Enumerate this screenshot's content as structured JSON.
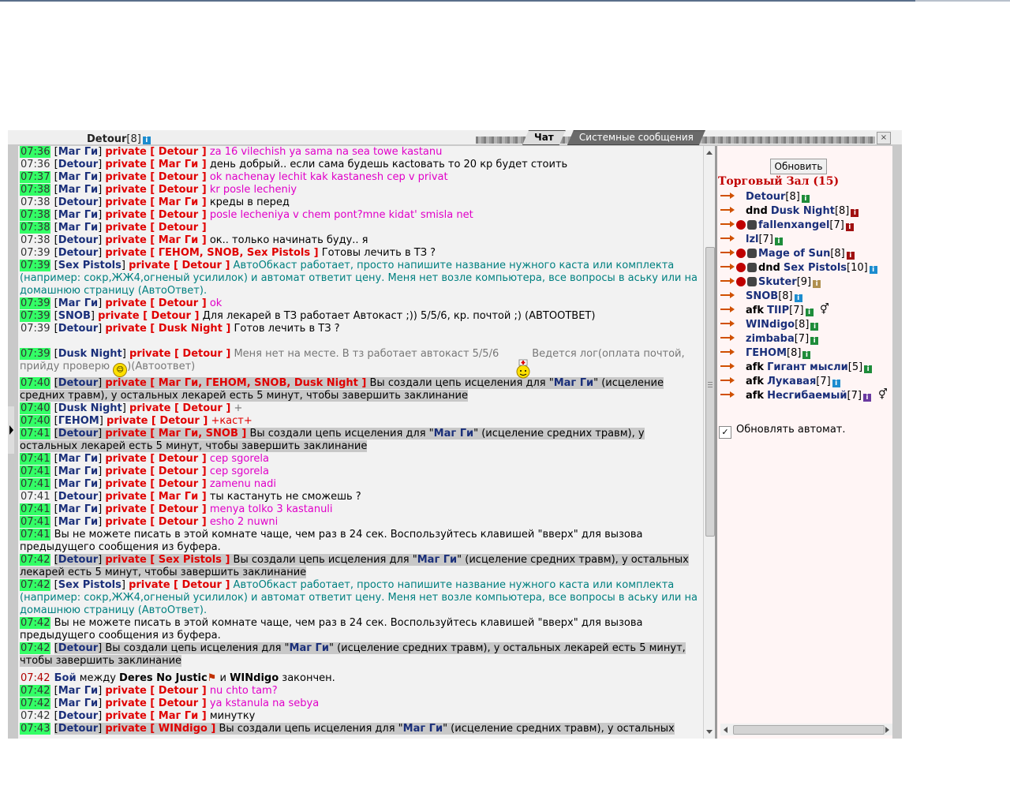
{
  "self": {
    "name": "Detour",
    "level": "[8]"
  },
  "tabs": [
    {
      "label": "Чат"
    },
    {
      "label": "Системные сообщения"
    }
  ],
  "messages": [
    {
      "time": "07:36",
      "tstyle": "g",
      "from": "Маг Ги",
      "priv": "private [ Detour ]",
      "text": "za 16 vilechish ya sama na sea towe kastanu",
      "tc": "mag"
    },
    {
      "time": "07:36",
      "tstyle": "p",
      "from": "Detour",
      "priv": "private [ Маг Ги ]",
      "text": "день добрый.. если сама будешь касtовать то 20 кр будет стоить",
      "tc": "blk"
    },
    {
      "time": "07:37",
      "tstyle": "g",
      "from": "Маг Ги",
      "priv": "private [ Detour ]",
      "text": "ok nachenay lechit kak kastanesh cep v privat",
      "tc": "mag"
    },
    {
      "time": "07:38",
      "tstyle": "g",
      "from": "Маг Ги",
      "priv": "private [ Detour ]",
      "text": "kr posle lecheniy",
      "tc": "mag"
    },
    {
      "time": "07:38",
      "tstyle": "p",
      "from": "Detour",
      "priv": "private [ Маг Ги ]",
      "text": "креды в перед",
      "tc": "blk"
    },
    {
      "time": "07:38",
      "tstyle": "g",
      "from": "Маг Ги",
      "priv": "private [ Detour ]",
      "text": "posle lecheniya v chem pont?mne kidat' smisla net",
      "tc": "mag"
    },
    {
      "time": "07:38",
      "tstyle": "g",
      "from": "Маг Ги",
      "priv": "private [ Detour ]",
      "text": "",
      "tc": "mag"
    },
    {
      "time": "07:38",
      "tstyle": "p",
      "from": "Detour",
      "priv": "private [ Маг Ги ]",
      "text": "ок.. только начинать буду.. я",
      "tc": "blk"
    },
    {
      "time": "07:39",
      "tstyle": "p",
      "from": "Detour",
      "priv": "private [ ГЕНОМ, SNOB, Sex Pistols ]",
      "text": "Готовы лечить в ТЗ ?",
      "tc": "blk"
    },
    {
      "time": "07:39",
      "tstyle": "g",
      "from": "Sex Pistols",
      "priv": "private [ Detour ]",
      "text": "АвтоОбкаст работает, просто напишите название нужного каста или комплекта (например: сокр,ЖЖ4,огненый усилилок) и автомат ответит цену. Меня нет возле компьютера, все вопросы в аську или на домашнюю страницу (АвтоОтвет).",
      "tc": "teal"
    },
    {
      "time": "07:39",
      "tstyle": "g",
      "from": "Маг Ги",
      "priv": "private [ Detour ]",
      "text": "ok",
      "tc": "mag"
    },
    {
      "time": "07:39",
      "tstyle": "g",
      "from": "SNOB",
      "priv": "private [ Detour ]",
      "text": "Для лекарей в ТЗ работает Автокаст ;)) 5/5/6, кр. почтой ;) (АВТООТВЕТ)",
      "tc": "blk"
    },
    {
      "time": "07:39",
      "tstyle": "p",
      "from": "Detour",
      "priv": "private [ Dusk Night ]",
      "text": "Готов лечить в ТЗ ?",
      "tc": "blk"
    }
  ],
  "msg_dusk": {
    "time": "07:39",
    "from": "Dusk Night",
    "priv": "private [ Detour ]",
    "text1": "Меня нет на месте. В тз работает автокаст 5/5/6",
    "text2": "Ведется лог(оплата почтой,",
    "text3": "прийду проверю",
    "text4": ")(Автоответ)"
  },
  "messages2": [
    {
      "time": "07:40",
      "tstyle": "g",
      "from": "Detour",
      "priv": "private [ Маг Ги, ГЕНОМ, SNOB, Dusk Night ]",
      "pre": "Вы создали цепь исцеления для \"",
      "target": "Маг Ги",
      "post": "\" (исцеление средних травм), у остальных лекарей есть 5 минут, чтобы завершить заклинание",
      "hl": true
    },
    {
      "time": "07:40",
      "tstyle": "g",
      "from": "Dusk Night",
      "priv": "private [ Detour ]",
      "text": "+",
      "tc": "gray"
    },
    {
      "time": "07:40",
      "tstyle": "g",
      "from": "ГЕНОМ",
      "priv": "private [ Detour ]",
      "text": "+каст+",
      "tc": "red"
    },
    {
      "time": "07:41",
      "tstyle": "g",
      "from": "Detour",
      "priv": "private [ Маг Ги, SNOB ]",
      "pre": "Вы создали цепь исцеления для \"",
      "target": "Маг Ги",
      "post": "\" (исцеление средних травм), у остальных лекарей есть 5 минут, чтобы завершить заклинание",
      "hl": true
    },
    {
      "time": "07:41",
      "tstyle": "g",
      "from": "Маг Ги",
      "priv": "private [ Detour ]",
      "text": "cep sgorela",
      "tc": "mag"
    },
    {
      "time": "07:41",
      "tstyle": "g",
      "from": "Маг Ги",
      "priv": "private [ Detour ]",
      "text": "cep sgorela",
      "tc": "mag"
    },
    {
      "time": "07:41",
      "tstyle": "g",
      "from": "Маг Ги",
      "priv": "private [ Detour ]",
      "text": "zamenu nadi",
      "tc": "mag"
    },
    {
      "time": "07:41",
      "tstyle": "p",
      "from": "Detour",
      "priv": "private [ Маг Ги ]",
      "text": "ты кастануть не сможешь ?",
      "tc": "blk"
    },
    {
      "time": "07:41",
      "tstyle": "g",
      "from": "Маг Ги",
      "priv": "private [ Detour ]",
      "text": "menya tolko 3 kastanuli",
      "tc": "mag"
    },
    {
      "time": "07:41",
      "tstyle": "g",
      "from": "Маг Ги",
      "priv": "private [ Detour ]",
      "text": "esho 2 nuwni",
      "tc": "mag"
    },
    {
      "time": "07:41",
      "tstyle": "g",
      "sys": "Вы не можете писать в этой комнате чаще, чем раз в 24 сек. Воспользуйтесь клавишей \"вверх\" для вызова предыдущего сообщения из буфера."
    },
    {
      "time": "07:42",
      "tstyle": "g",
      "from": "Detour",
      "priv": "private [ Sex Pistols ]",
      "pre": "Вы создали цепь исцеления для \"",
      "target": "Маг Ги",
      "post": "\" (исцеление средних травм), у остальных лекарей есть 5 минут, чтобы завершить заклинание",
      "hl": true
    },
    {
      "time": "07:42",
      "tstyle": "g",
      "from": "Sex Pistols",
      "priv": "private [ Detour ]",
      "text": "АвтоОбкаст работает, просто напишите название нужного каста или комплекта (например: сокр,ЖЖ4,огненый усилилок) и автомат ответит цену. Меня нет возле компьютера, все вопросы в аську или на домашнюю страницу (АвтоОтвет).",
      "tc": "teal"
    },
    {
      "time": "07:42",
      "tstyle": "g",
      "sys": "Вы не можете писать в этой комнате чаще, чем раз в 24 сек. Воспользуйтесь клавишей \"вверх\" для вызова предыдущего сообщения из буфера."
    },
    {
      "time": "07:42",
      "tstyle": "g",
      "from": "Detour",
      "priv": "",
      "pre": "Вы создали цепь исцеления для \"",
      "target": "Маг Ги",
      "post": "\" (исцеление средних травм), у остальных лекарей есть 5 минут, чтобы завершить заклинание",
      "hl": true
    }
  ],
  "battle": {
    "time": "07:42",
    "label": "Бой",
    "between": "между",
    "p1": "Deres No Justic",
    "and": "и",
    "p2": "WINdigo",
    "end": "закончен."
  },
  "messages3": [
    {
      "time": "07:42",
      "tstyle": "g",
      "from": "Маг Ги",
      "priv": "private [ Detour ]",
      "text": "nu chto tam?",
      "tc": "mag"
    },
    {
      "time": "07:42",
      "tstyle": "g",
      "from": "Маг Ги",
      "priv": "private [ Detour ]",
      "text": "ya kstanula na sebya",
      "tc": "mag"
    },
    {
      "time": "07:42",
      "tstyle": "p",
      "from": "Detour",
      "priv": "private [ Маг Ги ]",
      "text": "минутку",
      "tc": "blk"
    },
    {
      "time": "07:43",
      "tstyle": "g",
      "from": "Detour",
      "priv": "private [ WINdigo ]",
      "pre": "Вы создали цепь исцеления для \"",
      "target": "Маг Ги",
      "post": "\" (исцеление средних травм), у остальных",
      "hl": true
    }
  ],
  "right": {
    "refresh_label": "Обновить",
    "room_title": "Торговый Зал (15)",
    "users": [
      {
        "afk": "",
        "name": "Detour",
        "level": "[8]",
        "info": "green",
        "icons": []
      },
      {
        "afk": "dnd",
        "name": "Dusk Night",
        "level": "[8]",
        "info": "red",
        "icons": []
      },
      {
        "afk": "",
        "name": "fallenxangel",
        "level": "[7]",
        "info": "red",
        "icons": [
          "kr",
          "pic"
        ]
      },
      {
        "afk": "",
        "name": "lzl",
        "level": "[7]",
        "info": "green",
        "icons": []
      },
      {
        "afk": "",
        "name": "Mage of Sun",
        "level": "[8]",
        "info": "red",
        "icons": [
          "kr",
          "pic"
        ]
      },
      {
        "afk": "dnd",
        "name": "Sex Pistols",
        "level": "[10]",
        "info": "blue",
        "icons": [
          "kr",
          "pic"
        ]
      },
      {
        "afk": "",
        "name": "Skuter",
        "level": "[9]",
        "info": "tan",
        "icons": [
          "kr",
          "pic"
        ]
      },
      {
        "afk": "",
        "name": "SNOB",
        "level": "[8]",
        "info": "blue",
        "icons": []
      },
      {
        "afk": "afk",
        "name": "TIIP",
        "level": "[7]",
        "info": "green",
        "icons": [],
        "dec": true
      },
      {
        "afk": "",
        "name": "WINdigo",
        "level": "[8]",
        "info": "green",
        "icons": []
      },
      {
        "afk": "",
        "name": "zimbaba",
        "level": "[7]",
        "info": "green",
        "icons": []
      },
      {
        "afk": "",
        "name": "ГЕНОМ",
        "level": "[8]",
        "info": "green",
        "icons": []
      },
      {
        "afk": "afk",
        "name": "Гигант мысли",
        "level": "[5]",
        "info": "green",
        "icons": []
      },
      {
        "afk": "afk",
        "name": "Лукавая",
        "level": "[7]",
        "info": "blue",
        "icons": []
      },
      {
        "afk": "afk",
        "name": "Несгибаемый",
        "level": "[7]",
        "info": "purple",
        "icons": [],
        "dec": true
      }
    ],
    "auto_update_label": "Обновлять автомат.",
    "auto_update_checked": "✓"
  }
}
